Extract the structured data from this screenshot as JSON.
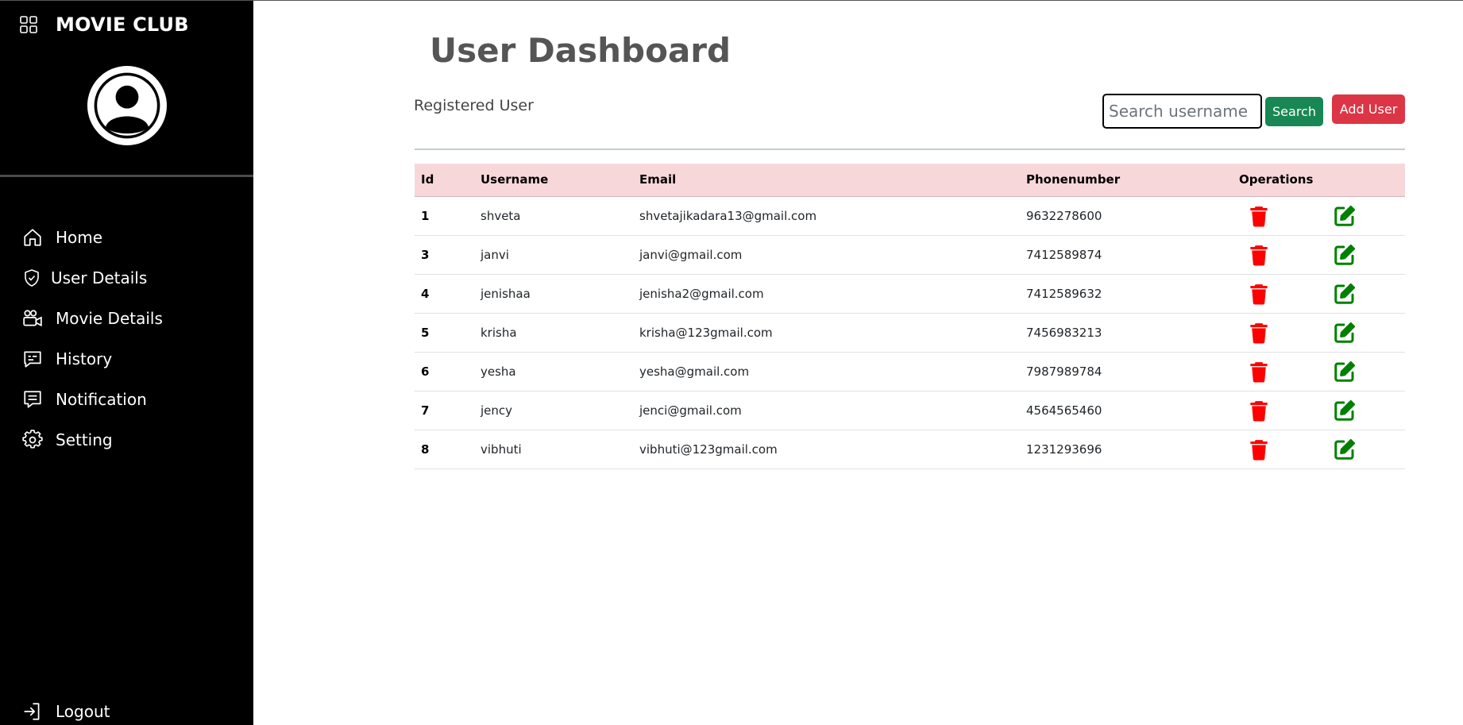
{
  "brand": {
    "title": "MOVIE CLUB",
    "icon": "grid-icon"
  },
  "avatar": {
    "icon": "user-circle-icon"
  },
  "sidebar": {
    "items": [
      {
        "label": "Home",
        "icon": "home-icon"
      },
      {
        "label": "User Details",
        "icon": "shield-check-icon"
      },
      {
        "label": "Movie Details",
        "icon": "camera-reels-icon"
      },
      {
        "label": "History",
        "icon": "chat-text-icon"
      },
      {
        "label": "Notification",
        "icon": "chat-lines-icon"
      },
      {
        "label": "Setting",
        "icon": "gear-icon"
      }
    ],
    "logout": {
      "label": "Logout",
      "icon": "logout-icon"
    }
  },
  "main": {
    "title": "User Dashboard",
    "subtitle": "Registered User",
    "search": {
      "placeholder": "Search username",
      "value": "",
      "button": "Search"
    },
    "add_button": "Add User"
  },
  "table": {
    "headers": [
      "Id",
      "Username",
      "Email",
      "Phonenumber",
      "Operations"
    ],
    "rows": [
      {
        "id": "1",
        "username": "shveta",
        "email": "shvetajikadara13@gmail.com",
        "phone": "9632278600"
      },
      {
        "id": "3",
        "username": "janvi",
        "email": "janvi@gmail.com",
        "phone": "7412589874"
      },
      {
        "id": "4",
        "username": "jenishaa",
        "email": "jenisha2@gmail.com",
        "phone": "7412589632"
      },
      {
        "id": "5",
        "username": "krisha",
        "email": "krisha@123gmail.com",
        "phone": "7456983213"
      },
      {
        "id": "6",
        "username": "yesha",
        "email": "yesha@gmail.com",
        "phone": "7987989784"
      },
      {
        "id": "7",
        "username": "jency",
        "email": "jenci@gmail.com",
        "phone": "4564565460"
      },
      {
        "id": "8",
        "username": "vibhuti",
        "email": "vibhuti@123gmail.com",
        "phone": "1231293696"
      }
    ]
  },
  "colors": {
    "sidebar_bg": "#000000",
    "header_row_bg": "#f8d7da",
    "search_button": "#198754",
    "add_button": "#dc3545",
    "delete_icon": "#ff0000",
    "edit_icon": "#008000"
  }
}
